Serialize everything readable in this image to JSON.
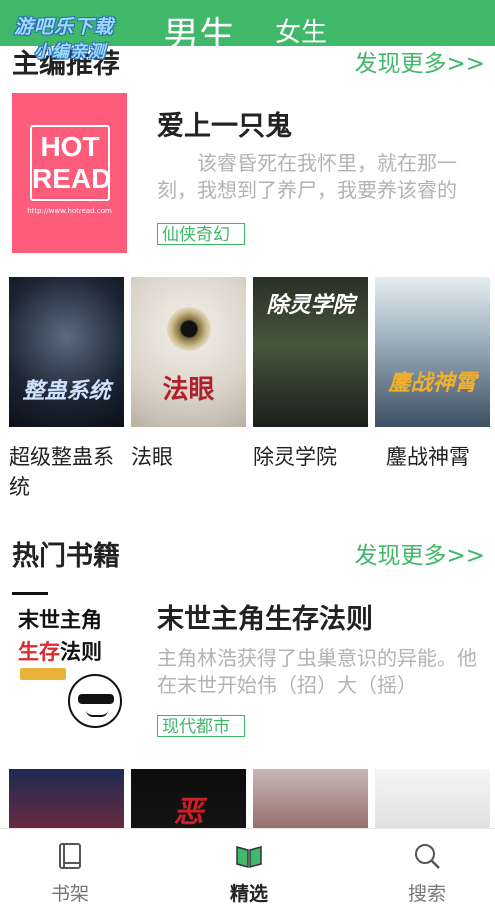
{
  "watermark": {
    "line1": "游吧乐下载",
    "line2": "小编亲测"
  },
  "header": {
    "tabs": [
      {
        "label": "男生",
        "active": true
      },
      {
        "label": "女生",
        "active": false
      }
    ],
    "bg_color": "#3fb86a"
  },
  "editor_picks": {
    "title": "主编推荐",
    "more": "发现更多>>",
    "featured": {
      "cover_text_1": "HOT",
      "cover_text_2": "READ",
      "cover_url": "http://www.hotread.com",
      "title": "爱上一只鬼",
      "description": "该睿昏死在我怀里，就在那一刻，我想到了养尸，我要养该睿的",
      "tag": "仙侠奇幻"
    },
    "books": [
      {
        "name": "超级整蛊系统",
        "cover_text": "整蛊系统"
      },
      {
        "name": "法眼",
        "cover_text": "法眼"
      },
      {
        "name": "除灵学院",
        "cover_text": "除灵学院"
      },
      {
        "name": "鏖战神霄",
        "cover_text": "鏖战神霄"
      }
    ]
  },
  "hot_books": {
    "title": "热门书籍",
    "more": "发现更多>>",
    "featured": {
      "cover_line1": "末世主角",
      "cover_line2_red": "生存",
      "cover_line2_rest": "法则",
      "title": "末世主角生存法则",
      "description": "主角林浩获得了虫巢意识的异能。他在末世开始伟（招）大（摇）",
      "tag": "现代都市"
    },
    "books": [
      {
        "cover_text": ""
      },
      {
        "cover_text": "恶"
      },
      {
        "cover_text": ""
      },
      {
        "cover_text": ""
      }
    ]
  },
  "bottom_nav": [
    {
      "label": "书架",
      "icon": "book-icon",
      "active": false
    },
    {
      "label": "精选",
      "icon": "open-book-icon",
      "active": true
    },
    {
      "label": "搜索",
      "icon": "search-icon",
      "active": false
    }
  ],
  "colors": {
    "accent": "#3fb86a",
    "muted_text": "#b3b3b3"
  }
}
